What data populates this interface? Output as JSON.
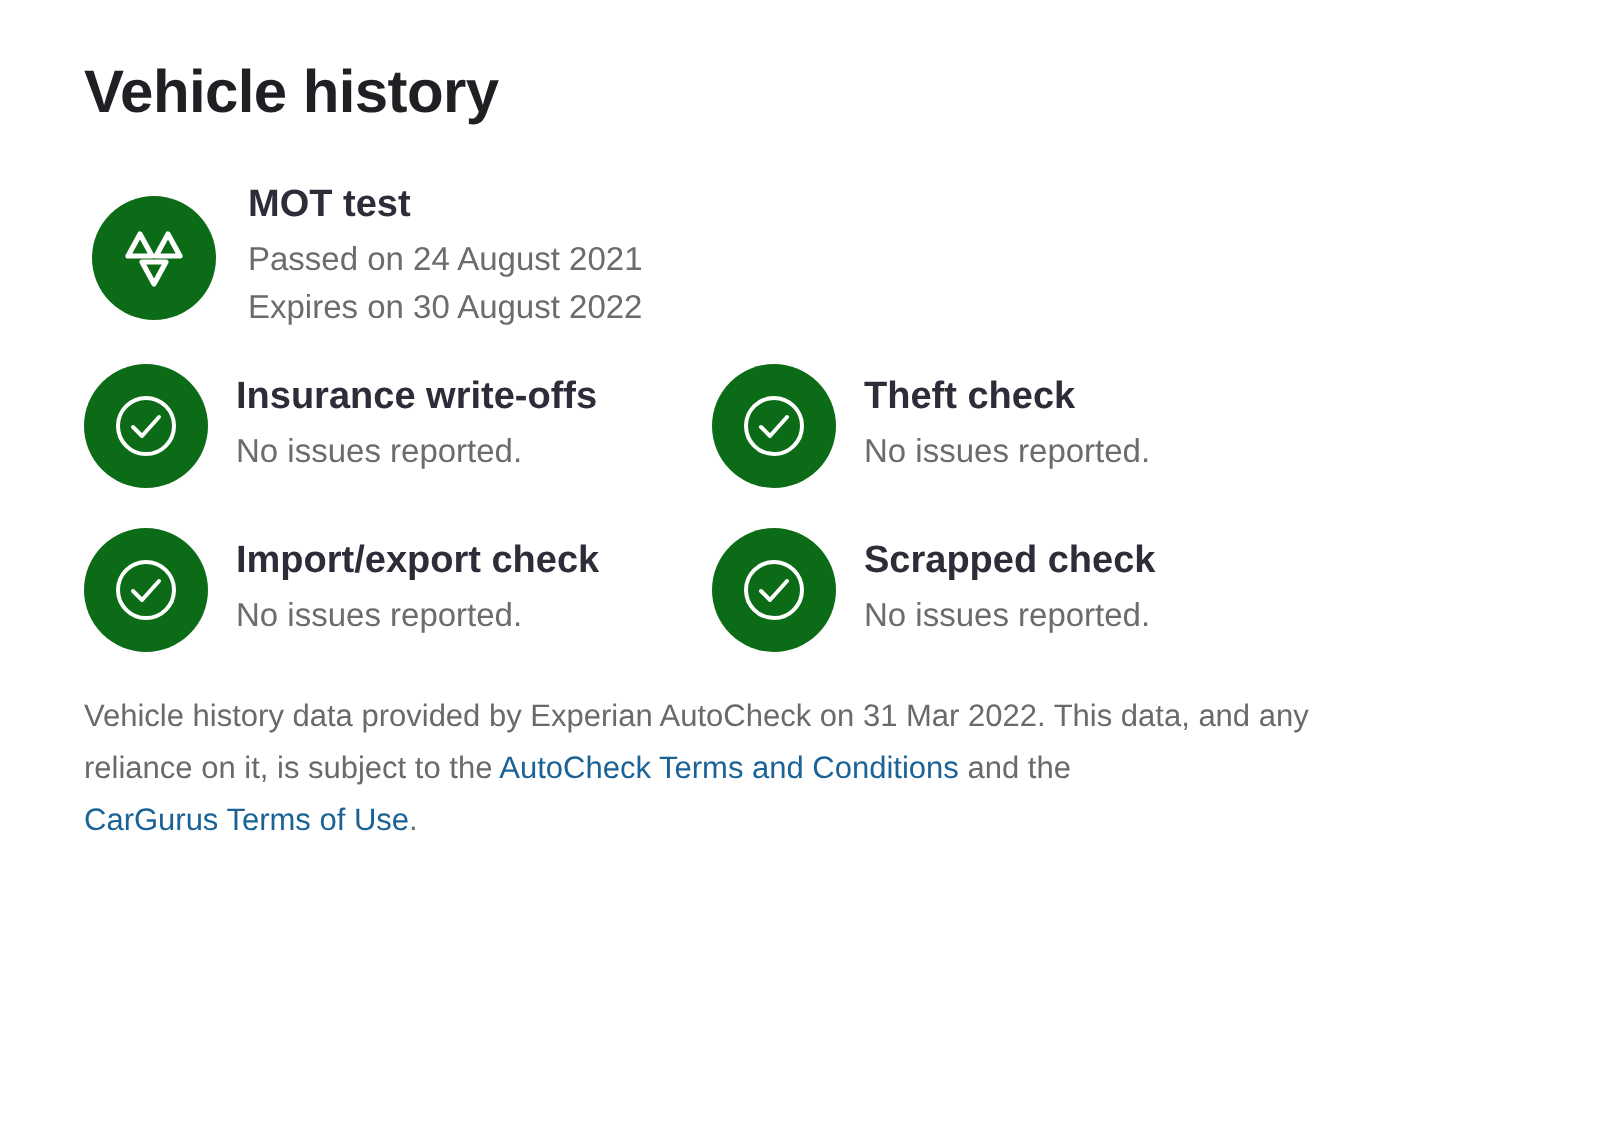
{
  "title": "Vehicle history",
  "mot": {
    "title": "MOT test",
    "lines": [
      "Passed on 24 August 2021",
      "Expires on 30 August 2022"
    ]
  },
  "checks": [
    {
      "title": "Insurance write-offs",
      "status": "No issues reported."
    },
    {
      "title": "Theft check",
      "status": "No issues reported."
    },
    {
      "title": "Import/export check",
      "status": "No issues reported."
    },
    {
      "title": "Scrapped check",
      "status": "No issues reported."
    }
  ],
  "footer": [
    {
      "kind": "text",
      "text": "Vehicle history data provided by Experian AutoCheck on 31 Mar 2022. This data, and any reliance on it, is subject to the "
    },
    {
      "kind": "link",
      "text": "AutoCheck Terms and Conditions"
    },
    {
      "kind": "text",
      "text": " and the "
    },
    {
      "kind": "link",
      "text": "CarGurus Terms of Use"
    },
    {
      "kind": "text",
      "text": "."
    }
  ]
}
